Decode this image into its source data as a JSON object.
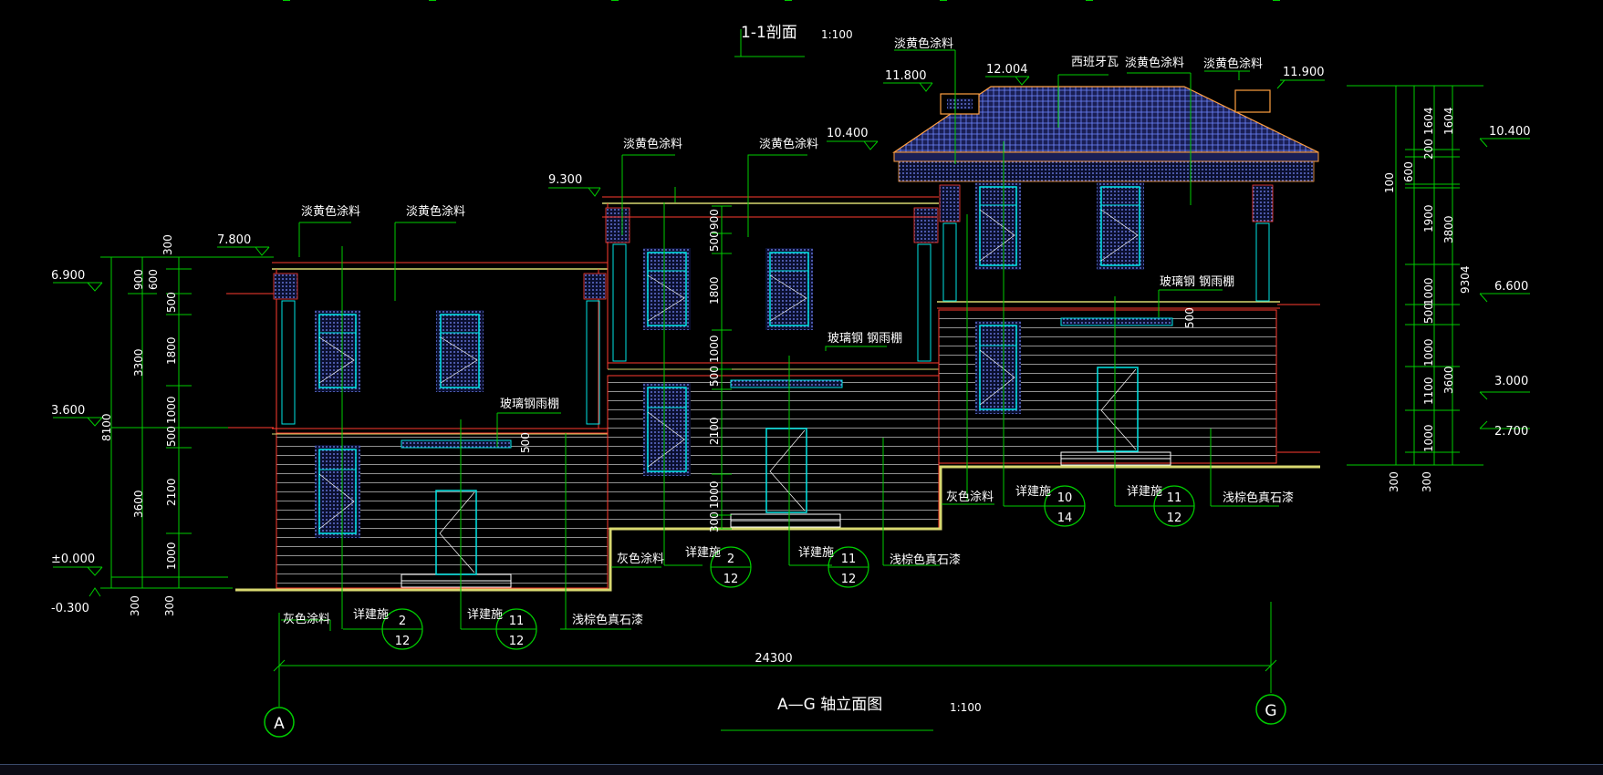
{
  "section_title": "1-1剖面",
  "section_scale": "1:100",
  "elevation_title": "A—G 轴立面图",
  "elevation_scale": "1:100",
  "total_length": "24300",
  "axis_left": "A",
  "axis_right": "G",
  "level_marks": {
    "l_6900": "6.900",
    "l_3600": "3.600",
    "l_000": "±0.000",
    "l_m300": "-0.300",
    "l_7800": "7.800",
    "l_9300": "9.300",
    "l_10400a": "10.400",
    "l_11800": "11.800",
    "l_12004": "12.004",
    "l_11900": "11.900",
    "r_10400": "10.400",
    "r_6600": "6.600",
    "r_3000": "3.000",
    "r_2700": "2.700"
  },
  "left_dims": {
    "d300": "300",
    "d900": "900",
    "d600": "600",
    "d500a": "500",
    "d1800": "1800",
    "d1000a": "1000",
    "d500b": "500",
    "d2100": "2100",
    "d1000b": "1000",
    "d3300": "3300",
    "d3600": "3600",
    "d8100": "8100",
    "d300b": "300",
    "d300c": "300"
  },
  "mid_dims": {
    "d900": "900",
    "d500a": "500",
    "d1800": "1800",
    "d1000": "1000",
    "d500b": "500",
    "d2100": "2100",
    "d1000b": "1000",
    "d300": "300"
  },
  "right_dims": {
    "d1604a": "1604",
    "d1604b": "1604",
    "d200": "200",
    "d100": "100",
    "d600": "600",
    "d1900": "1900",
    "d1000a": "1000",
    "d500": "500",
    "d1000b": "1000",
    "d1100": "1100",
    "d1000c": "1000",
    "d3800": "3800",
    "d3600": "3600",
    "d9304": "9304",
    "d300a": "300",
    "d300b": "300"
  },
  "notes": {
    "paint_yellow": "淡黄色涂料",
    "paint_grey": "灰色涂料",
    "canopy": "玻璃钢雨棚",
    "canopy_b": "玻璃钢 钢雨棚",
    "spanish_tile": "西班牙瓦",
    "detail": "详建施",
    "stone": "浅棕色真石漆",
    "stone_b": "浅棕色真石漆",
    "dim500": "500"
  },
  "detail_callouts": [
    {
      "top": "2",
      "bottom": "12"
    },
    {
      "top": "11",
      "bottom": "12"
    },
    {
      "top": "2",
      "bottom": "12"
    },
    {
      "top": "11",
      "bottom": "12"
    },
    {
      "top": "10",
      "bottom": "14"
    },
    {
      "top": "11",
      "bottom": "12"
    }
  ],
  "colors": {
    "background": "#000000",
    "dim_lines": "#00cc00",
    "wall_outline": "#ff3b30",
    "window": "#00e5e5",
    "roof": "#6f86ff",
    "ground": "#d8d870",
    "text": "#ffffff"
  }
}
